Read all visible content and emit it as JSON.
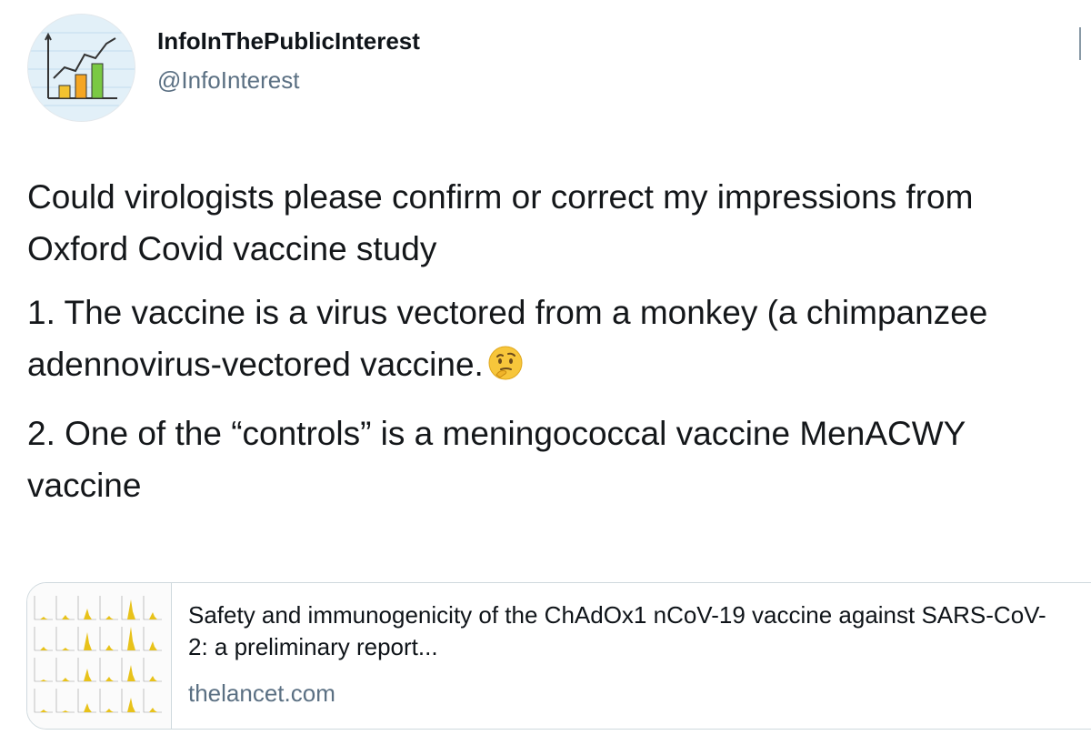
{
  "author": {
    "display_name": "InfoInThePublicInterest",
    "handle": "@InfoInterest",
    "avatar_icon": "chart-avatar-icon"
  },
  "tweet": {
    "paragraphs": [
      "Could virologists please confirm or correct my impressions from Oxford Covid vaccine study",
      "1. The vaccine is a virus vectored from a monkey (a chimpanzee adennovirus-vectored vaccine.",
      "2. One of the “controls” is a meningococcal vaccine MenACWY vaccine"
    ],
    "emoji": "thinking-face-icon"
  },
  "link_card": {
    "title": "Safety and immunogenicity of the ChAdOx1 nCoV-19 vaccine against SARS-CoV-2: a preliminary report...",
    "domain": "thelancet.com",
    "thumbnail_icon": "histogram-grid-thumbnail"
  },
  "colors": {
    "text": "#0f1419",
    "secondary": "#5b7083",
    "border": "#cfd9de",
    "accent_yellow": "#e8c21a"
  }
}
